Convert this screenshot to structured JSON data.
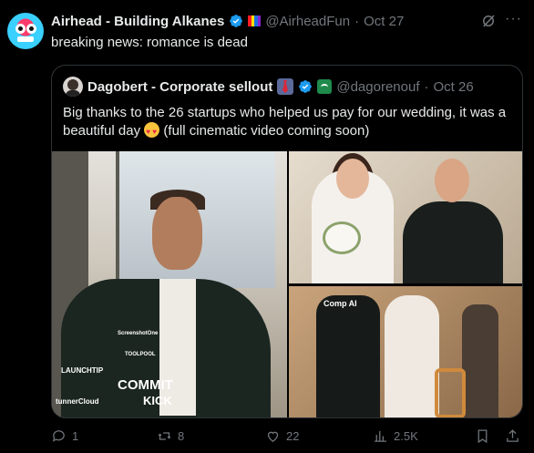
{
  "tweet": {
    "author_name": "Airhead - Building Alkanes",
    "handle": "@AirheadFun",
    "separator": "·",
    "date": "Oct 27",
    "text": "breaking news: romance is dead",
    "more_label": "···"
  },
  "quoted": {
    "author_name": "Dagobert - Corporate sellout",
    "handle": "@dagorenouf",
    "separator": "·",
    "date": "Oct 26",
    "text_part1": "Big thanks to the 26 startups who helped us pay for our wedding, it was a beautiful day",
    "text_part2": "(full cinematic video coming soon)",
    "media": {
      "photo1_labels": [
        "ScreenshotOne",
        "TOOLPOOL",
        "LAUNCHTIP",
        "COMMIT",
        "KICK",
        "tunnerCloud"
      ],
      "photo3_label": "Comp AI"
    }
  },
  "actions": {
    "replies": "1",
    "reposts": "8",
    "likes": "22",
    "views": "2.5K"
  },
  "colors": {
    "background": "#000000",
    "text": "#e7e9ea",
    "muted": "#71767b",
    "verified": "#1d9bf0",
    "border": "#2f3336"
  }
}
